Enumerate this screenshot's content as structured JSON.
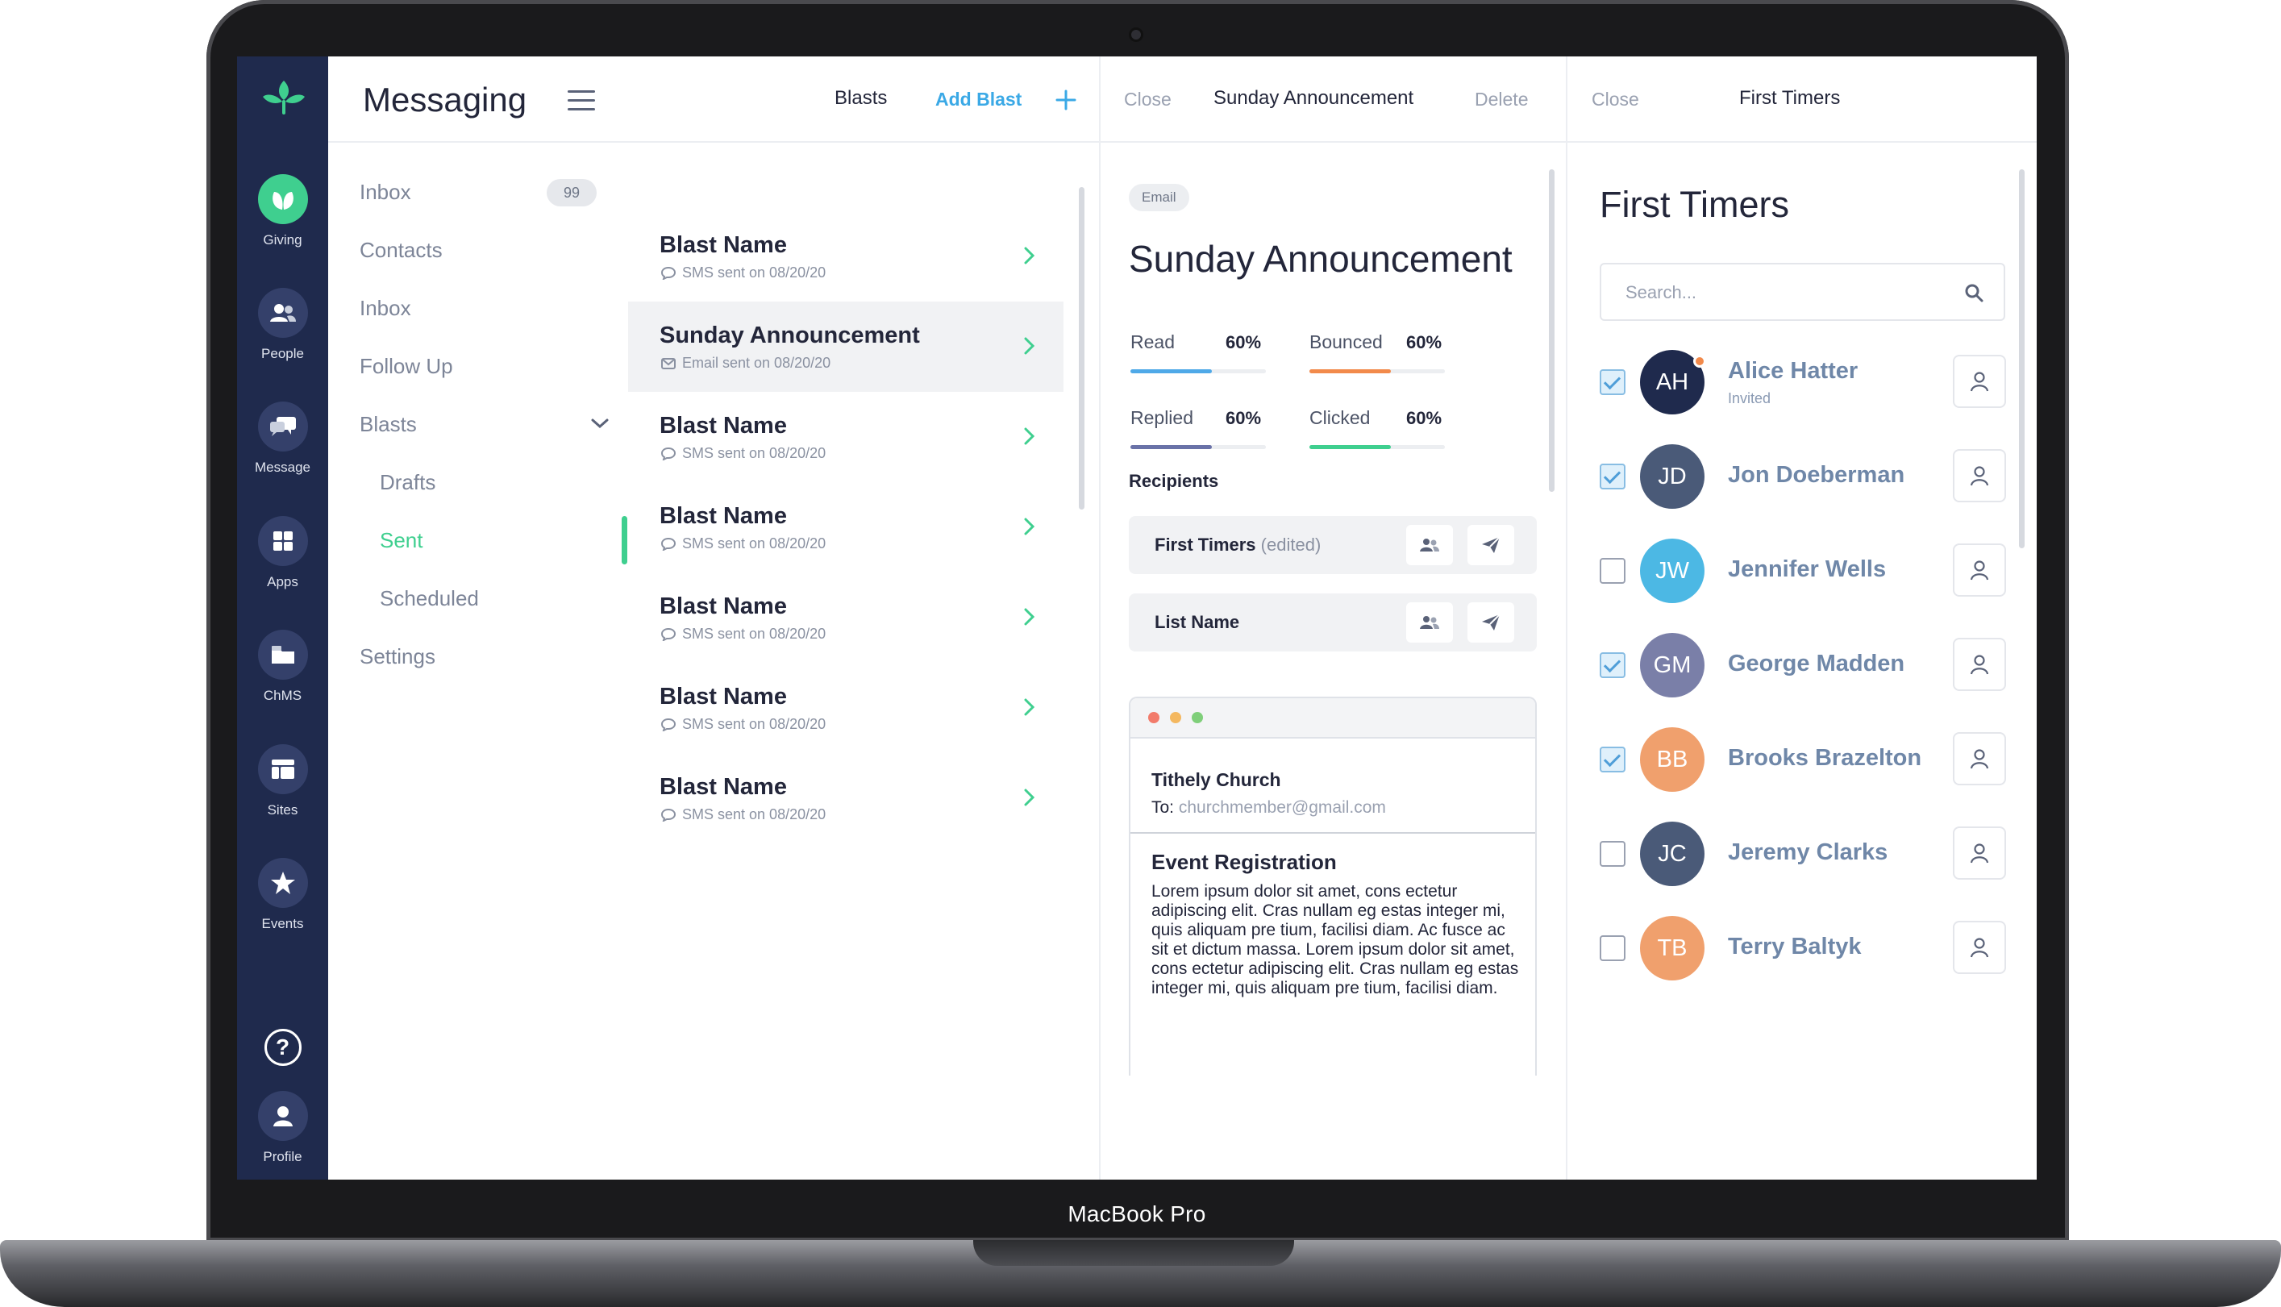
{
  "device": {
    "label": "MacBook Pro"
  },
  "rail": {
    "items": [
      {
        "label": "Giving",
        "icon": "leaf-icon",
        "active": true
      },
      {
        "label": "People",
        "icon": "people-icon"
      },
      {
        "label": "Message",
        "icon": "chat-icon"
      },
      {
        "label": "Apps",
        "icon": "grid-icon"
      },
      {
        "label": "ChMS",
        "icon": "folder-icon"
      },
      {
        "label": "Sites",
        "icon": "layout-icon"
      },
      {
        "label": "Events",
        "icon": "star-icon"
      }
    ],
    "help_icon": "?",
    "profile_label": "Profile"
  },
  "header": {
    "app_title": "Messaging",
    "blasts": "Blasts",
    "add_blast": "Add Blast",
    "detail_close": "Close",
    "detail_title": "Sunday Announcement",
    "detail_delete": "Delete",
    "people_close": "Close",
    "people_title": "First Timers"
  },
  "nav": {
    "inbox": "Inbox",
    "inbox_count": "99",
    "contacts": "Contacts",
    "inbox2": "Inbox",
    "follow_up": "Follow Up",
    "blasts": "Blasts",
    "drafts": "Drafts",
    "sent": "Sent",
    "scheduled": "Scheduled",
    "settings": "Settings"
  },
  "blasts": [
    {
      "name": "Blast Name",
      "meta": "SMS sent on 08/20/20",
      "kind": "sms"
    },
    {
      "name": "Sunday Announcement",
      "meta": "Email sent on 08/20/20",
      "kind": "email",
      "selected": true
    },
    {
      "name": "Blast Name",
      "meta": "SMS sent on 08/20/20",
      "kind": "sms"
    },
    {
      "name": "Blast Name",
      "meta": "SMS sent on 08/20/20",
      "kind": "sms"
    },
    {
      "name": "Blast Name",
      "meta": "SMS sent on 08/20/20",
      "kind": "sms"
    },
    {
      "name": "Blast Name",
      "meta": "SMS sent on 08/20/20",
      "kind": "sms"
    },
    {
      "name": "Blast Name",
      "meta": "SMS sent on 08/20/20",
      "kind": "sms"
    }
  ],
  "detail": {
    "type_pill": "Email",
    "title": "Sunday Announcement",
    "stats": [
      {
        "label": "Read",
        "value": "60%",
        "level": 0.6,
        "color": "#4fa9e8"
      },
      {
        "label": "Bounced",
        "value": "60%",
        "level": 0.6,
        "color": "#f28a4b"
      },
      {
        "label": "Replied",
        "value": "60%",
        "level": 0.6,
        "color": "#6a72a8"
      },
      {
        "label": "Clicked",
        "value": "60%",
        "level": 0.6,
        "color": "#3fcf8f"
      }
    ],
    "recipients_label": "Recipients",
    "recipients": [
      {
        "name": "First Timers",
        "note": "(edited)"
      },
      {
        "name": "List Name",
        "note": ""
      }
    ],
    "email": {
      "from": "Tithely Church",
      "to_label": "To:",
      "to_address": "churchmember@gmail.com",
      "subject": "Event Registration",
      "body": "Lorem ipsum dolor sit amet, cons ectetur adipiscing elit. Cras nullam eg estas integer mi, quis aliquam pre tium, facilisi diam. Ac fusce ac sit et dictum massa. Lorem ipsum dolor sit amet, cons ectetur adipiscing elit. Cras nullam eg estas integer mi, quis aliquam pre tium, facilisi diam."
    }
  },
  "people": {
    "title": "First Timers",
    "search_placeholder": "Search...",
    "list": [
      {
        "initials": "AH",
        "name": "Alice Hatter",
        "sub": "Invited",
        "checked": true,
        "color": "#1f2a4d",
        "dot": true
      },
      {
        "initials": "JD",
        "name": "Jon Doeberman",
        "checked": true,
        "color": "#4a5a78"
      },
      {
        "initials": "JW",
        "name": "Jennifer Wells",
        "checked": false,
        "color": "#4cb8e4"
      },
      {
        "initials": "GM",
        "name": "George Madden",
        "checked": true,
        "color": "#7a7fa8"
      },
      {
        "initials": "BB",
        "name": "Brooks Brazelton",
        "checked": true,
        "color": "#f0a06d"
      },
      {
        "initials": "JC",
        "name": "Jeremy Clarks",
        "checked": false,
        "color": "#4a5a78"
      },
      {
        "initials": "TB",
        "name": "Terry Baltyk",
        "checked": false,
        "color": "#f0a06d"
      }
    ]
  }
}
